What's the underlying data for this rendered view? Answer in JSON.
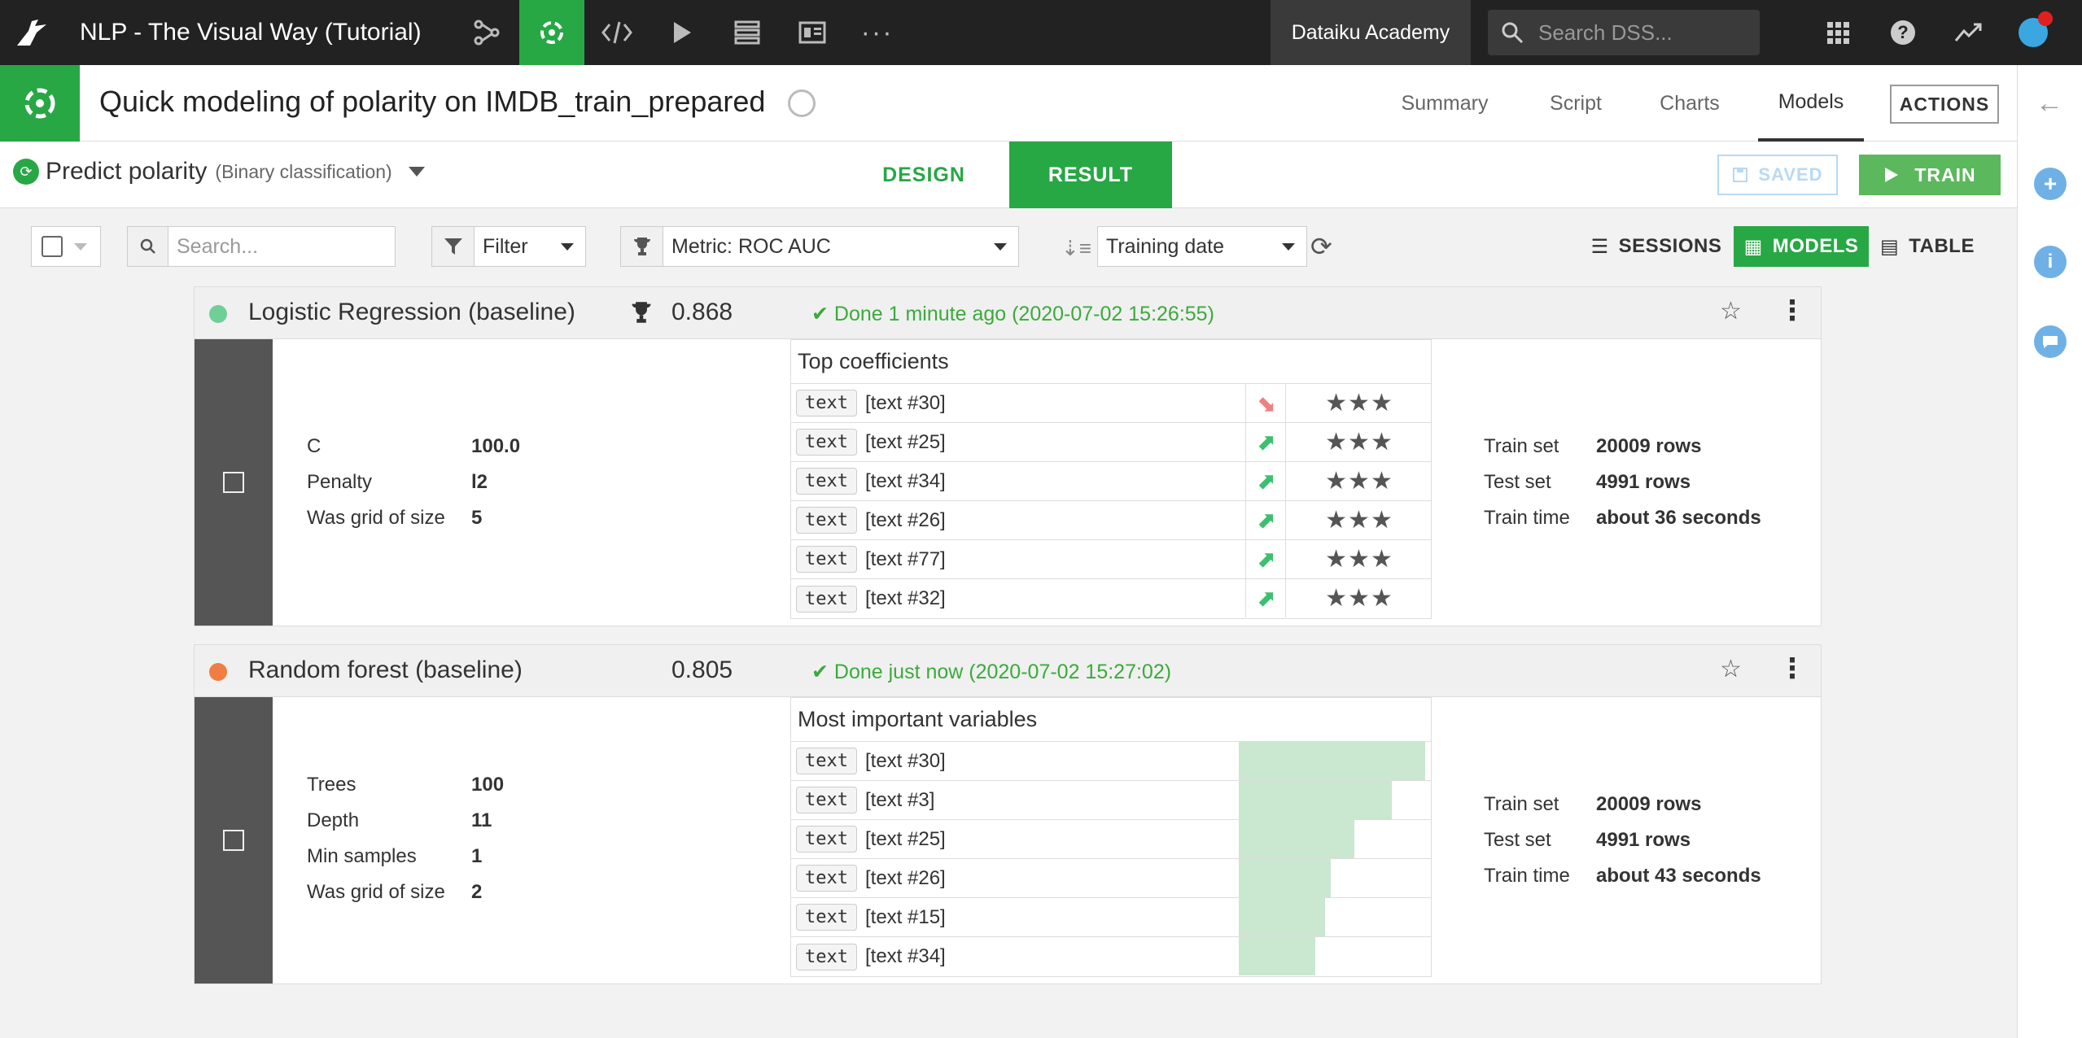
{
  "topnav": {
    "project_title": "NLP - The Visual Way (Tutorial)",
    "academy_label": "Dataiku Academy",
    "search_placeholder": "Search DSS..."
  },
  "header": {
    "title": "Quick modeling of polarity on IMDB_train_prepared",
    "tabs": [
      "Summary",
      "Script",
      "Charts",
      "Models"
    ],
    "active_tab": "Models",
    "actions_label": "ACTIONS"
  },
  "task": {
    "name": "Predict polarity",
    "type": "(Binary classification)",
    "design_label": "DESIGN",
    "result_label": "RESULT",
    "saved_label": "SAVED",
    "train_label": "TRAIN"
  },
  "toolbar": {
    "search_placeholder": "Search...",
    "filter_label": "Filter",
    "metric_label": "Metric: ROC AUC",
    "sort_label": "Training date",
    "sessions_label": "SESSIONS",
    "models_label": "MODELS",
    "table_label": "TABLE"
  },
  "models": [
    {
      "name": "Logistic Regression (baseline)",
      "dot_color": "#6fcf97",
      "score": "0.868",
      "best": true,
      "status": "Done 1 minute ago (2020-07-02 15:26:55)",
      "params": [
        {
          "k": "C",
          "v": "100.0"
        },
        {
          "k": "Penalty",
          "v": "l2"
        },
        {
          "k": "Was grid of size",
          "v": "5"
        }
      ],
      "panel_title": "Top coefficients",
      "tag_label": "text",
      "features": [
        {
          "name": "[text #30]",
          "direction": "down"
        },
        {
          "name": "[text #25]",
          "direction": "up"
        },
        {
          "name": "[text #34]",
          "direction": "up"
        },
        {
          "name": "[text #26]",
          "direction": "up"
        },
        {
          "name": "[text #77]",
          "direction": "up"
        },
        {
          "name": "[text #32]",
          "direction": "up"
        }
      ],
      "stars": "★★★",
      "stats": [
        {
          "k": "Train set",
          "v": "20009 rows"
        },
        {
          "k": "Test set",
          "v": "4991 rows"
        },
        {
          "k": "Train time",
          "v": "about 36 seconds"
        }
      ]
    },
    {
      "name": "Random forest (baseline)",
      "dot_color": "#f07d42",
      "score": "0.805",
      "best": false,
      "status": "Done just now (2020-07-02 15:27:02)",
      "params": [
        {
          "k": "Trees",
          "v": "100"
        },
        {
          "k": "Depth",
          "v": "11"
        },
        {
          "k": "Min samples",
          "v": "1"
        },
        {
          "k": "Was grid of size",
          "v": "2"
        }
      ],
      "panel_title": "Most important variables",
      "tag_label": "text",
      "features": [
        {
          "name": "[text #30]",
          "importance": 1.0
        },
        {
          "name": "[text #3]",
          "importance": 0.82
        },
        {
          "name": "[text #25]",
          "importance": 0.62
        },
        {
          "name": "[text #26]",
          "importance": 0.49
        },
        {
          "name": "[text #15]",
          "importance": 0.46
        },
        {
          "name": "[text #34]",
          "importance": 0.41
        }
      ],
      "stats": [
        {
          "k": "Train set",
          "v": "20009 rows"
        },
        {
          "k": "Test set",
          "v": "4991 rows"
        },
        {
          "k": "Train time",
          "v": "about 43 seconds"
        }
      ]
    }
  ]
}
